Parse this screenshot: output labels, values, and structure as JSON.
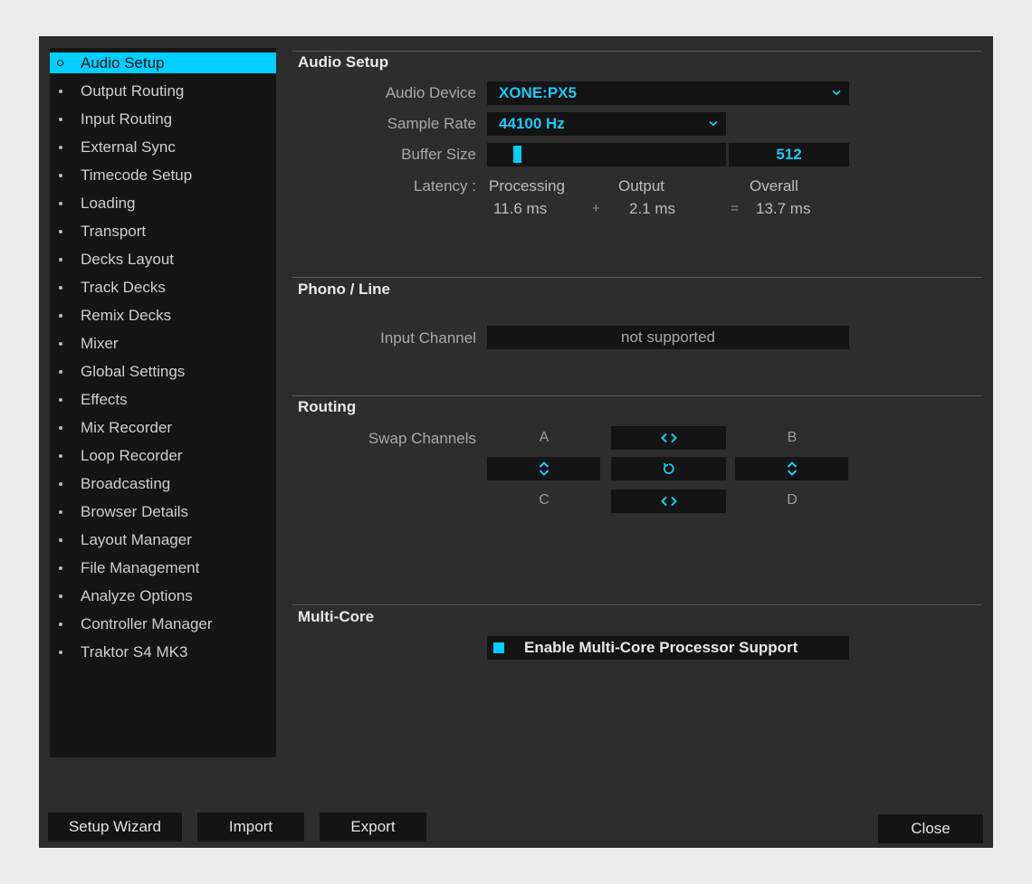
{
  "nav": {
    "items": [
      {
        "label": "Audio Setup",
        "active": true
      },
      {
        "label": "Output Routing"
      },
      {
        "label": "Input Routing"
      },
      {
        "label": "External Sync"
      },
      {
        "label": "Timecode Setup"
      },
      {
        "label": "Loading"
      },
      {
        "label": "Transport"
      },
      {
        "label": "Decks Layout"
      },
      {
        "label": "Track Decks"
      },
      {
        "label": "Remix Decks"
      },
      {
        "label": "Mixer"
      },
      {
        "label": "Global Settings"
      },
      {
        "label": "Effects"
      },
      {
        "label": "Mix Recorder"
      },
      {
        "label": "Loop Recorder"
      },
      {
        "label": "Broadcasting"
      },
      {
        "label": "Browser Details"
      },
      {
        "label": "Layout Manager"
      },
      {
        "label": "File Management"
      },
      {
        "label": "Analyze Options"
      },
      {
        "label": "Controller Manager"
      },
      {
        "label": "Traktor S4 MK3"
      }
    ]
  },
  "audio_setup": {
    "title": "Audio Setup",
    "device_label": "Audio Device",
    "device_value": "XONE:PX5",
    "sample_rate_label": "Sample Rate",
    "sample_rate_value": "44100 Hz",
    "buffer_label": "Buffer Size",
    "buffer_value": "512",
    "buffer_slider_position": 0.13,
    "latency_label": "Latency :",
    "processing_label": "Processing",
    "processing_value": "11.6 ms",
    "plus": "+",
    "output_label": "Output",
    "output_value": "2.1 ms",
    "equals": "=",
    "overall_label": "Overall",
    "overall_value": "13.7 ms"
  },
  "phono_line": {
    "title": "Phono / Line",
    "input_label": "Input Channel",
    "input_value": "not supported"
  },
  "routing": {
    "title": "Routing",
    "swap_label": "Swap Channels",
    "a": "A",
    "b": "B",
    "c": "C",
    "d": "D"
  },
  "multicore": {
    "title": "Multi-Core",
    "checkbox_label": "Enable Multi-Core Processor Support",
    "checked": true
  },
  "buttons": {
    "setup_wizard": "Setup Wizard",
    "import": "Import",
    "export": "Export",
    "close": "Close"
  },
  "colors": {
    "accent": "#00cfff",
    "panel": "#2d2d2d",
    "control": "#141414"
  }
}
